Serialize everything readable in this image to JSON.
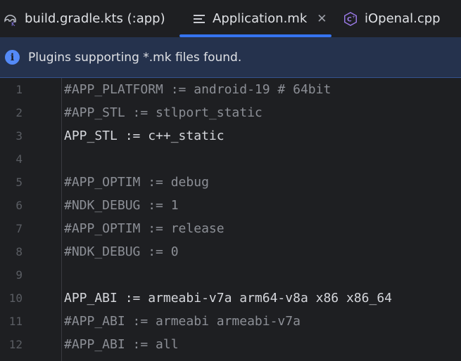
{
  "tabs": [
    {
      "label": "build.gradle.kts (:app)",
      "icon": "gradle-elephant-icon",
      "active": false
    },
    {
      "label": "Application.mk",
      "icon": "text-lines-icon",
      "active": true,
      "close": "✕"
    },
    {
      "label": "iOpenal.cpp",
      "icon": "cpp-file-icon",
      "active": false
    }
  ],
  "banner": {
    "icon": "info-icon",
    "text": "Plugins supporting *.mk files found."
  },
  "editor": {
    "lines": [
      {
        "num": "1",
        "text": "#APP_PLATFORM := android-19 # 64bit",
        "kind": "comment"
      },
      {
        "num": "2",
        "text": "#APP_STL := stlport_static",
        "kind": "comment"
      },
      {
        "num": "3",
        "text": "APP_STL := c++_static",
        "kind": "plain"
      },
      {
        "num": "4",
        "text": "",
        "kind": "plain"
      },
      {
        "num": "5",
        "text": "#APP_OPTIM := debug",
        "kind": "comment"
      },
      {
        "num": "6",
        "text": "#NDK_DEBUG := 1",
        "kind": "comment"
      },
      {
        "num": "7",
        "text": "#APP_OPTIM := release",
        "kind": "comment"
      },
      {
        "num": "8",
        "text": "#NDK_DEBUG := 0",
        "kind": "comment"
      },
      {
        "num": "9",
        "text": "",
        "kind": "plain"
      },
      {
        "num": "10",
        "text": "APP_ABI := armeabi-v7a arm64-v8a x86 x86_64",
        "kind": "plain"
      },
      {
        "num": "11",
        "text": "#APP_ABI := armeabi armeabi-v7a",
        "kind": "comment"
      },
      {
        "num": "12",
        "text": "#APP_ABI := all",
        "kind": "comment"
      }
    ]
  },
  "colors": {
    "background": "#1e1f22",
    "accent": "#3574f0",
    "banner": "#25324d",
    "comment": "#8c8f96",
    "code": "#d5d7dc"
  }
}
